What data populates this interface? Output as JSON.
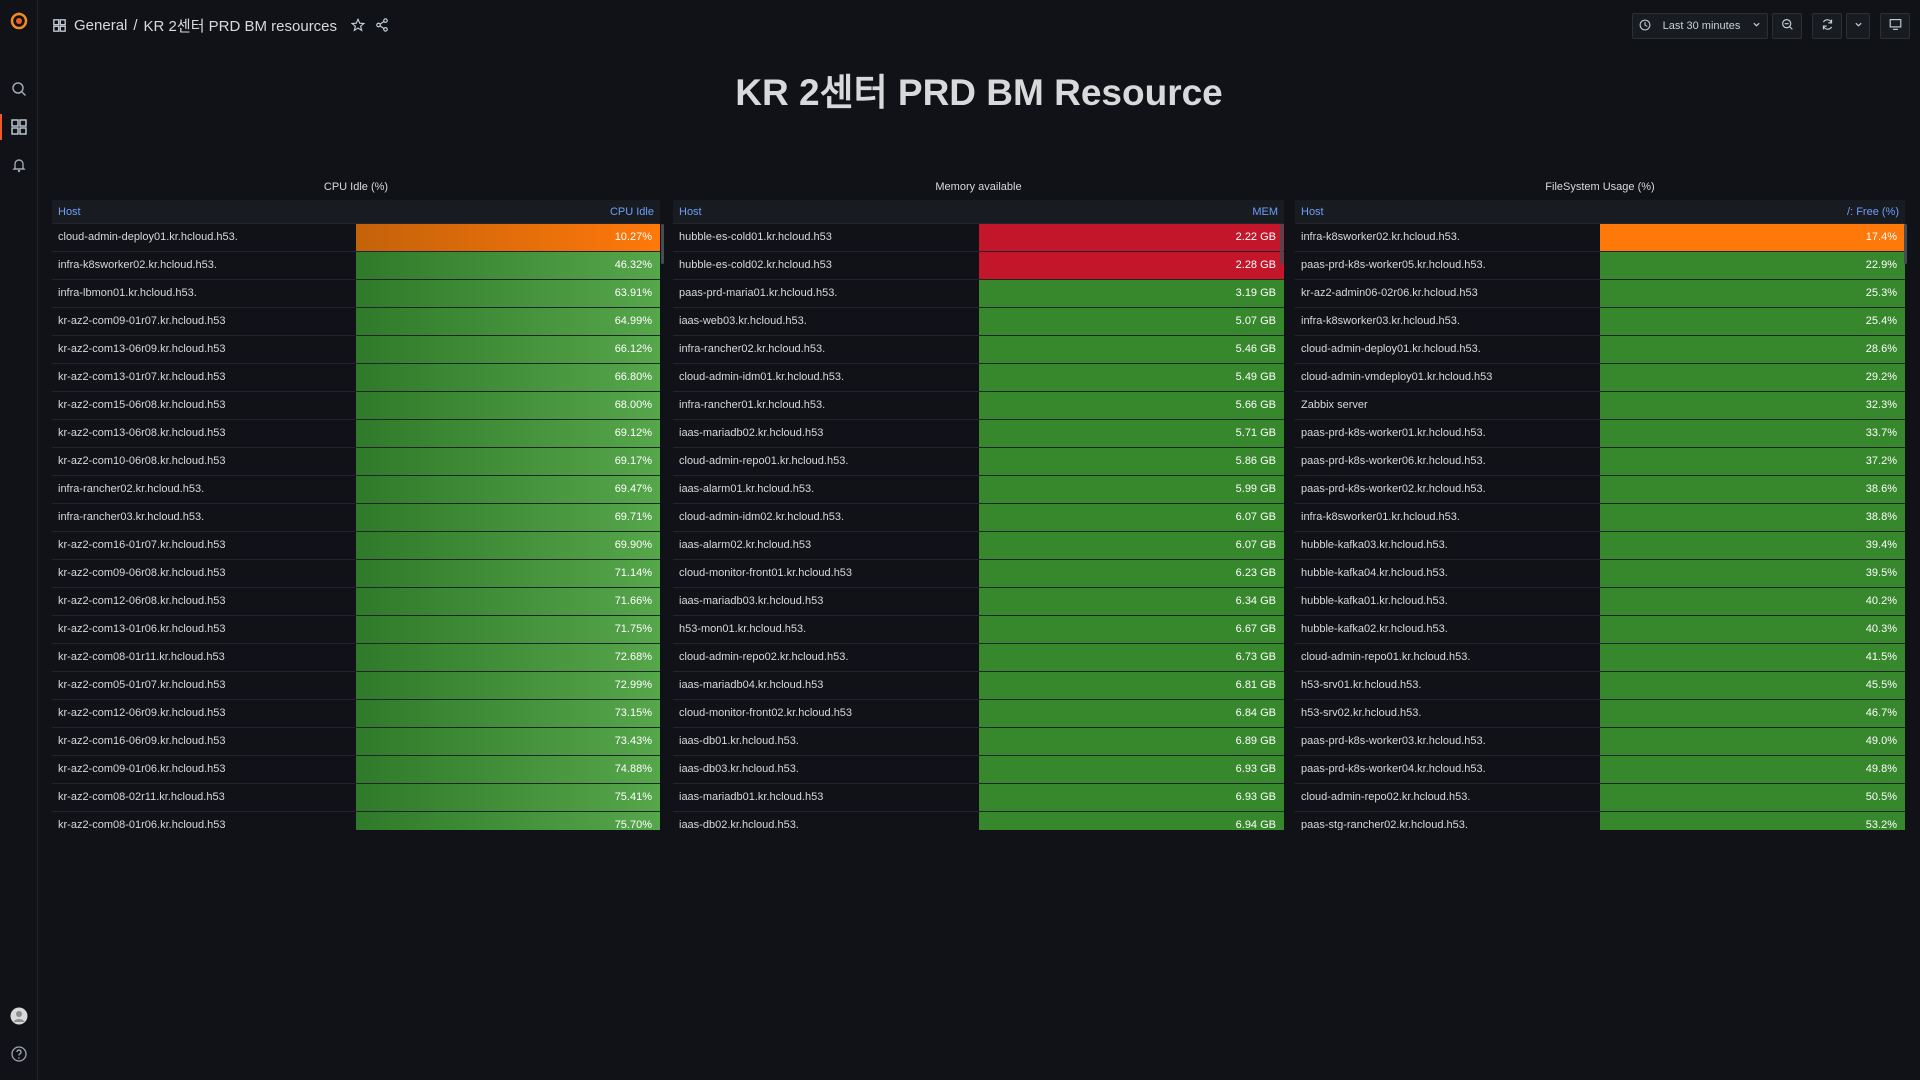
{
  "app": {
    "breadcrumb_folder": "General",
    "breadcrumb_sep": "/",
    "dashboard_name": "KR 2센터 PRD BM resources"
  },
  "toolbar": {
    "time_range": "Last 30 minutes"
  },
  "dashboard_title": "KR 2센터 PRD BM Resource",
  "colors": {
    "orange": "#ff780a",
    "red": "#c4162a",
    "green": "#37872d",
    "accent": "#f05a28"
  },
  "panels": [
    {
      "title": "CPU Idle (%)",
      "host_header": "Host",
      "value_header": "CPU Idle",
      "rows": [
        {
          "host": "cloud-admin-deploy01.kr.hcloud.h53.",
          "value": "10.27%",
          "level": 0.1027,
          "status": "orange"
        },
        {
          "host": "infra-k8sworker02.kr.hcloud.h53.",
          "value": "46.32%",
          "level": 0.4632,
          "status": "green"
        },
        {
          "host": "infra-lbmon01.kr.hcloud.h53.",
          "value": "63.91%",
          "level": 0.6391,
          "status": "green"
        },
        {
          "host": "kr-az2-com09-01r07.kr.hcloud.h53",
          "value": "64.99%",
          "level": 0.6499,
          "status": "green"
        },
        {
          "host": "kr-az2-com13-06r09.kr.hcloud.h53",
          "value": "66.12%",
          "level": 0.6612,
          "status": "green"
        },
        {
          "host": "kr-az2-com13-01r07.kr.hcloud.h53",
          "value": "66.80%",
          "level": 0.668,
          "status": "green"
        },
        {
          "host": "kr-az2-com15-06r08.kr.hcloud.h53",
          "value": "68.00%",
          "level": 0.68,
          "status": "green"
        },
        {
          "host": "kr-az2-com13-06r08.kr.hcloud.h53",
          "value": "69.12%",
          "level": 0.6912,
          "status": "green"
        },
        {
          "host": "kr-az2-com10-06r08.kr.hcloud.h53",
          "value": "69.17%",
          "level": 0.6917,
          "status": "green"
        },
        {
          "host": "infra-rancher02.kr.hcloud.h53.",
          "value": "69.47%",
          "level": 0.6947,
          "status": "green"
        },
        {
          "host": "infra-rancher03.kr.hcloud.h53.",
          "value": "69.71%",
          "level": 0.6971,
          "status": "green"
        },
        {
          "host": "kr-az2-com16-01r07.kr.hcloud.h53",
          "value": "69.90%",
          "level": 0.699,
          "status": "green"
        },
        {
          "host": "kr-az2-com09-06r08.kr.hcloud.h53",
          "value": "71.14%",
          "level": 0.7114,
          "status": "green"
        },
        {
          "host": "kr-az2-com12-06r08.kr.hcloud.h53",
          "value": "71.66%",
          "level": 0.7166,
          "status": "green"
        },
        {
          "host": "kr-az2-com13-01r06.kr.hcloud.h53",
          "value": "71.75%",
          "level": 0.7175,
          "status": "green"
        },
        {
          "host": "kr-az2-com08-01r11.kr.hcloud.h53",
          "value": "72.68%",
          "level": 0.7268,
          "status": "green"
        },
        {
          "host": "kr-az2-com05-01r07.kr.hcloud.h53",
          "value": "72.99%",
          "level": 0.7299,
          "status": "green"
        },
        {
          "host": "kr-az2-com12-06r09.kr.hcloud.h53",
          "value": "73.15%",
          "level": 0.7315,
          "status": "green"
        },
        {
          "host": "kr-az2-com16-06r09.kr.hcloud.h53",
          "value": "73.43%",
          "level": 0.7343,
          "status": "green"
        },
        {
          "host": "kr-az2-com09-01r06.kr.hcloud.h53",
          "value": "74.88%",
          "level": 0.7488,
          "status": "green"
        },
        {
          "host": "kr-az2-com08-02r11.kr.hcloud.h53",
          "value": "75.41%",
          "level": 0.7541,
          "status": "green"
        },
        {
          "host": "kr-az2-com08-01r06.kr.hcloud.h53",
          "value": "75.70%",
          "level": 0.757,
          "status": "green"
        }
      ]
    },
    {
      "title": "Memory available",
      "host_header": "Host",
      "value_header": "MEM",
      "rows": [
        {
          "host": "hubble-es-cold01.kr.hcloud.h53",
          "value": "2.22 GB",
          "status": "red"
        },
        {
          "host": "hubble-es-cold02.kr.hcloud.h53",
          "value": "2.28 GB",
          "status": "red"
        },
        {
          "host": "paas-prd-maria01.kr.hcloud.h53.",
          "value": "3.19 GB",
          "status": "green"
        },
        {
          "host": "iaas-web03.kr.hcloud.h53.",
          "value": "5.07 GB",
          "status": "green"
        },
        {
          "host": "infra-rancher02.kr.hcloud.h53.",
          "value": "5.46 GB",
          "status": "green"
        },
        {
          "host": "cloud-admin-idm01.kr.hcloud.h53.",
          "value": "5.49 GB",
          "status": "green"
        },
        {
          "host": "infra-rancher01.kr.hcloud.h53.",
          "value": "5.66 GB",
          "status": "green"
        },
        {
          "host": "iaas-mariadb02.kr.hcloud.h53",
          "value": "5.71 GB",
          "status": "green"
        },
        {
          "host": "cloud-admin-repo01.kr.hcloud.h53.",
          "value": "5.86 GB",
          "status": "green"
        },
        {
          "host": "iaas-alarm01.kr.hcloud.h53.",
          "value": "5.99 GB",
          "status": "green"
        },
        {
          "host": "cloud-admin-idm02.kr.hcloud.h53.",
          "value": "6.07 GB",
          "status": "green"
        },
        {
          "host": "iaas-alarm02.kr.hcloud.h53",
          "value": "6.07 GB",
          "status": "green"
        },
        {
          "host": "cloud-monitor-front01.kr.hcloud.h53",
          "value": "6.23 GB",
          "status": "green"
        },
        {
          "host": "iaas-mariadb03.kr.hcloud.h53",
          "value": "6.34 GB",
          "status": "green"
        },
        {
          "host": "h53-mon01.kr.hcloud.h53.",
          "value": "6.67 GB",
          "status": "green"
        },
        {
          "host": "cloud-admin-repo02.kr.hcloud.h53.",
          "value": "6.73 GB",
          "status": "green"
        },
        {
          "host": "iaas-mariadb04.kr.hcloud.h53",
          "value": "6.81 GB",
          "status": "green"
        },
        {
          "host": "cloud-monitor-front02.kr.hcloud.h53",
          "value": "6.84 GB",
          "status": "green"
        },
        {
          "host": "iaas-db01.kr.hcloud.h53.",
          "value": "6.89 GB",
          "status": "green"
        },
        {
          "host": "iaas-db03.kr.hcloud.h53.",
          "value": "6.93 GB",
          "status": "green"
        },
        {
          "host": "iaas-mariadb01.kr.hcloud.h53",
          "value": "6.93 GB",
          "status": "green"
        },
        {
          "host": "iaas-db02.kr.hcloud.h53.",
          "value": "6.94 GB",
          "status": "green"
        }
      ]
    },
    {
      "title": "FileSystem Usage (%)",
      "host_header": "Host",
      "value_header": "/: Free (%)",
      "rows": [
        {
          "host": "infra-k8sworker02.kr.hcloud.h53.",
          "value": "17.4%",
          "status": "orange"
        },
        {
          "host": "paas-prd-k8s-worker05.kr.hcloud.h53.",
          "value": "22.9%",
          "status": "green"
        },
        {
          "host": "kr-az2-admin06-02r06.kr.hcloud.h53",
          "value": "25.3%",
          "status": "green"
        },
        {
          "host": "infra-k8sworker03.kr.hcloud.h53.",
          "value": "25.4%",
          "status": "green"
        },
        {
          "host": "cloud-admin-deploy01.kr.hcloud.h53.",
          "value": "28.6%",
          "status": "green"
        },
        {
          "host": "cloud-admin-vmdeploy01.kr.hcloud.h53",
          "value": "29.2%",
          "status": "green"
        },
        {
          "host": "Zabbix server",
          "value": "32.3%",
          "status": "green"
        },
        {
          "host": "paas-prd-k8s-worker01.kr.hcloud.h53.",
          "value": "33.7%",
          "status": "green"
        },
        {
          "host": "paas-prd-k8s-worker06.kr.hcloud.h53.",
          "value": "37.2%",
          "status": "green"
        },
        {
          "host": "paas-prd-k8s-worker02.kr.hcloud.h53.",
          "value": "38.6%",
          "status": "green"
        },
        {
          "host": "infra-k8sworker01.kr.hcloud.h53.",
          "value": "38.8%",
          "status": "green"
        },
        {
          "host": "hubble-kafka03.kr.hcloud.h53.",
          "value": "39.4%",
          "status": "green"
        },
        {
          "host": "hubble-kafka04.kr.hcloud.h53.",
          "value": "39.5%",
          "status": "green"
        },
        {
          "host": "hubble-kafka01.kr.hcloud.h53.",
          "value": "40.2%",
          "status": "green"
        },
        {
          "host": "hubble-kafka02.kr.hcloud.h53.",
          "value": "40.3%",
          "status": "green"
        },
        {
          "host": "cloud-admin-repo01.kr.hcloud.h53.",
          "value": "41.5%",
          "status": "green"
        },
        {
          "host": "h53-srv01.kr.hcloud.h53.",
          "value": "45.5%",
          "status": "green"
        },
        {
          "host": "h53-srv02.kr.hcloud.h53.",
          "value": "46.7%",
          "status": "green"
        },
        {
          "host": "paas-prd-k8s-worker03.kr.hcloud.h53.",
          "value": "49.0%",
          "status": "green"
        },
        {
          "host": "paas-prd-k8s-worker04.kr.hcloud.h53.",
          "value": "49.8%",
          "status": "green"
        },
        {
          "host": "cloud-admin-repo02.kr.hcloud.h53.",
          "value": "50.5%",
          "status": "green"
        },
        {
          "host": "paas-stg-rancher02.kr.hcloud.h53.",
          "value": "53.2%",
          "status": "green"
        }
      ]
    }
  ]
}
